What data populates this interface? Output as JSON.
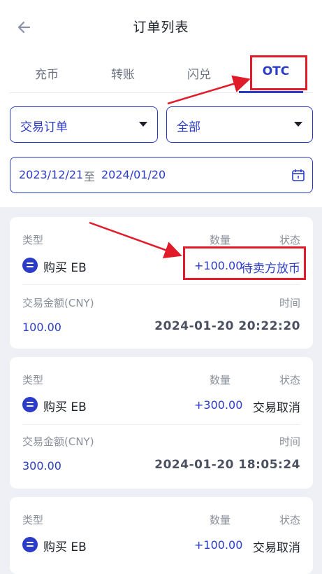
{
  "header": {
    "title": "订单列表",
    "back_icon": "arrow-left-icon"
  },
  "tabs": [
    {
      "label": "充币",
      "active": false
    },
    {
      "label": "转账",
      "active": false
    },
    {
      "label": "闪兑",
      "active": false
    },
    {
      "label": "OTC",
      "active": true
    }
  ],
  "filters": {
    "order_type": "交易订单",
    "status_filter": "全部",
    "date_from": "2023/12/21",
    "date_sep": "至",
    "date_to": "2024/01/20"
  },
  "labels": {
    "type": "类型",
    "quantity": "数量",
    "status": "状态",
    "amount": "交易金额(CNY)",
    "time": "时间"
  },
  "orders": [
    {
      "type": "购买 EB",
      "quantity": "+100.00",
      "status": "待卖方放币",
      "amount": "100.00",
      "time": "2024-01-20 20:22:20"
    },
    {
      "type": "购买 EB",
      "quantity": "+300.00",
      "status": "交易取消",
      "amount": "300.00",
      "time": "2024-01-20 18:05:24"
    },
    {
      "type": "购买 EB",
      "quantity": "+100.00",
      "status": "交易取消",
      "amount": "",
      "time": ""
    }
  ],
  "colors": {
    "accent": "#2b3cc8",
    "annotation": "#e11b2a",
    "background": "#eef0f5"
  }
}
